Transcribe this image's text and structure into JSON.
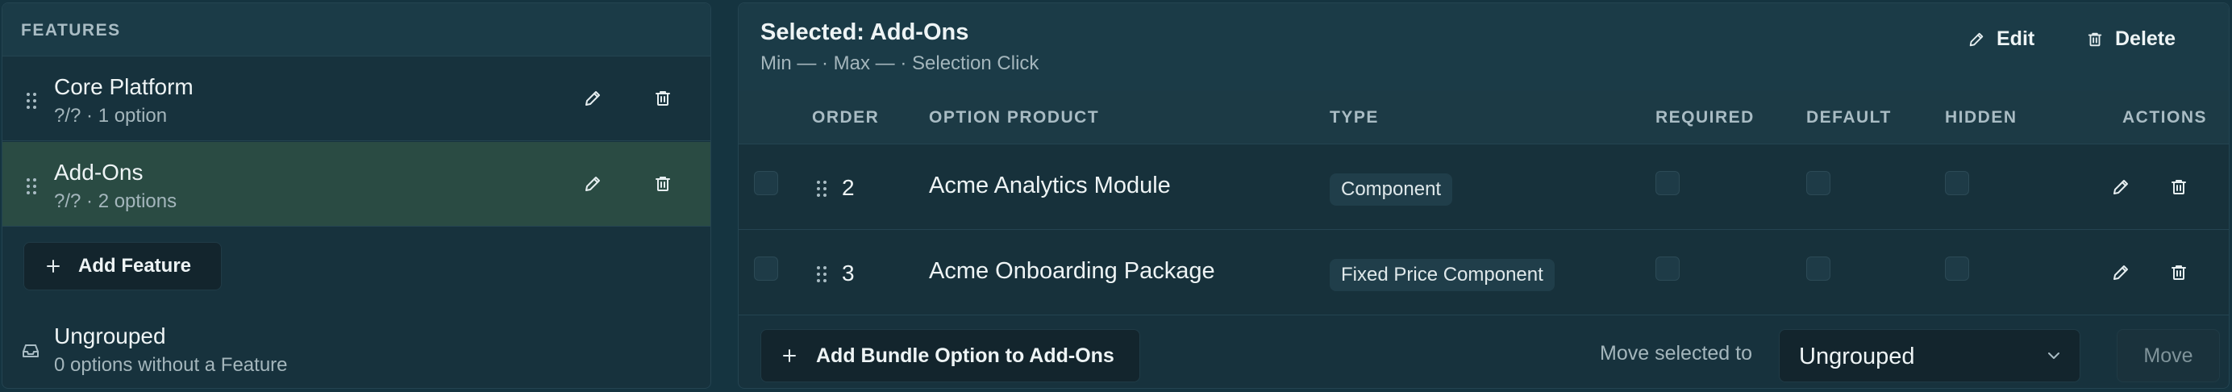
{
  "features_panel": {
    "header": "FEATURES",
    "items": [
      {
        "title": "Core Platform",
        "subtitle": "?/? · 1 option",
        "selected": false
      },
      {
        "title": "Add-Ons",
        "subtitle": "?/? · 2 options",
        "selected": true
      }
    ],
    "add_feature_label": "Add Feature",
    "ungrouped": {
      "title": "Ungrouped",
      "subtitle": "0 options without a Feature"
    }
  },
  "selected_panel": {
    "title": "Selected: Add-Ons",
    "subtitle": "Min — · Max — · Selection Click",
    "edit_label": "Edit",
    "delete_label": "Delete",
    "columns": {
      "order": "ORDER",
      "product": "OPTION PRODUCT",
      "type": "TYPE",
      "required": "REQUIRED",
      "default": "DEFAULT",
      "hidden": "HIDDEN",
      "actions": "ACTIONS"
    },
    "rows": [
      {
        "order": "2",
        "product": "Acme Analytics Module",
        "type": "Component",
        "required": false,
        "default": false,
        "hidden": false
      },
      {
        "order": "3",
        "product": "Acme Onboarding Package",
        "type": "Fixed Price Component",
        "required": false,
        "default": false,
        "hidden": false
      }
    ],
    "add_option_label": "Add Bundle Option to Add-Ons",
    "move_label": "Move selected to",
    "move_select_value": "Ungrouped",
    "move_button_label": "Move"
  },
  "colors": {
    "background": "#153440",
    "panel": "#17323d",
    "selected_feature": "#2a4b43",
    "text": "#eef4f5",
    "muted": "#a4b6bc"
  }
}
